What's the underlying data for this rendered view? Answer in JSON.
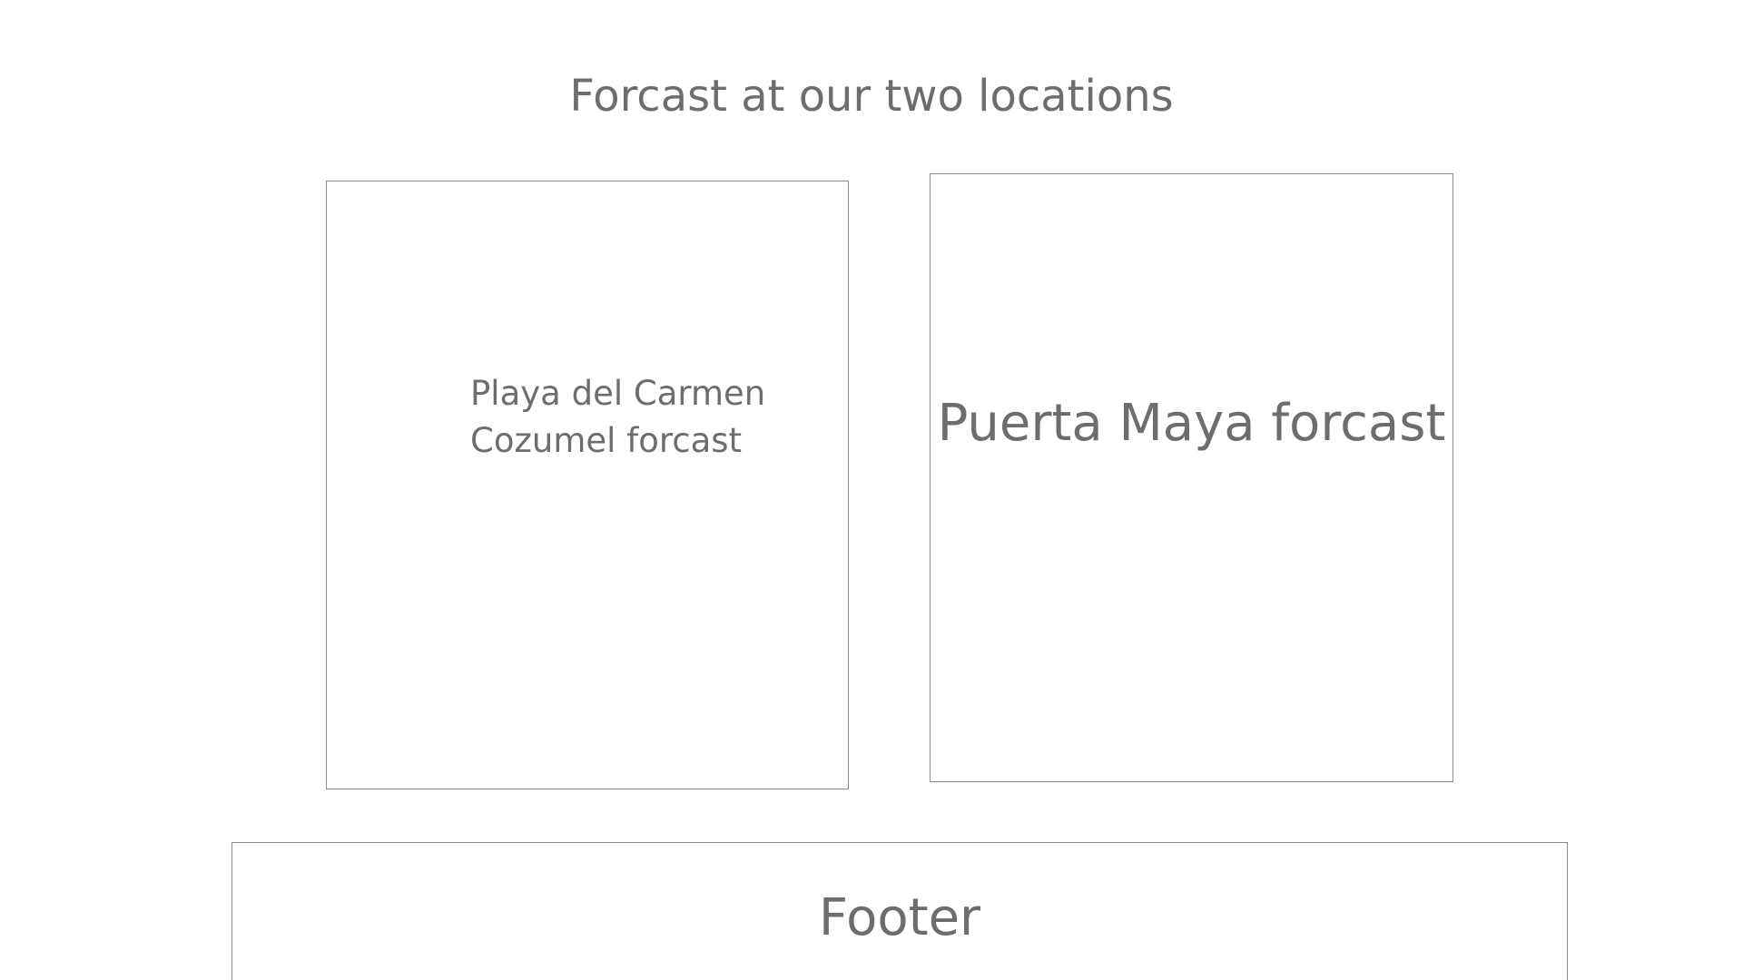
{
  "page": {
    "title": "Forcast at our two locations"
  },
  "panels": {
    "left": {
      "line1": "Playa del Carmen",
      "line2": "Cozumel forcast"
    },
    "right": {
      "label": "Puerta Maya forcast"
    }
  },
  "footer": {
    "label": "Footer"
  }
}
